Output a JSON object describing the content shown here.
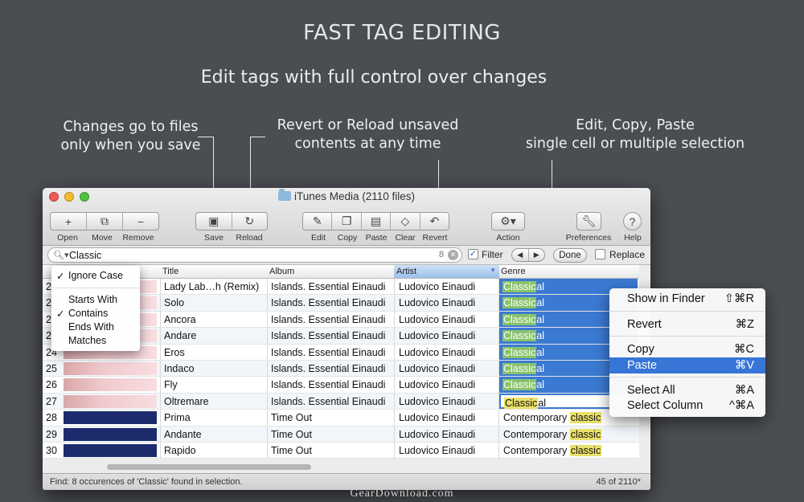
{
  "headline": "FAST TAG EDITING",
  "subhead": "Edit tags with full control over changes",
  "callouts": {
    "save": [
      "Changes go to files",
      "only when you save"
    ],
    "revert": [
      "Revert or Reload unsaved",
      "contents at any time"
    ],
    "edit": [
      "Edit, Copy, Paste",
      "single cell or multiple selection"
    ]
  },
  "window": {
    "title": "iTunes Media (2110 files)",
    "toolbar": {
      "open": "Open",
      "move": "Move",
      "remove": "Remove",
      "save": "Save",
      "reload": "Reload",
      "edit": "Edit",
      "copy": "Copy",
      "paste": "Paste",
      "clear": "Clear",
      "revert": "Revert",
      "action": "Action",
      "preferences": "Preferences",
      "help": "Help"
    },
    "search": {
      "value": "Classic",
      "count": "8",
      "filter_label": "Filter",
      "done_label": "Done",
      "replace_label": "Replace"
    },
    "columns": {
      "title": "Title",
      "album": "Album",
      "artist": "Artist",
      "genre": "Genre"
    },
    "rows": [
      {
        "num": "2",
        "title": "Lady Lab…h (Remix)",
        "album": "Islands. Essential Einaudi",
        "artist": "Ludovico Einaudi",
        "genre_match": "Classic",
        "genre_rest": "al"
      },
      {
        "num": "2",
        "title": "Solo",
        "album": "Islands. Essential Einaudi",
        "artist": "Ludovico Einaudi",
        "genre_match": "Classic",
        "genre_rest": "al"
      },
      {
        "num": "2",
        "title": "Ancora",
        "album": "Islands. Essential Einaudi",
        "artist": "Ludovico Einaudi",
        "genre_match": "Classic",
        "genre_rest": "al"
      },
      {
        "num": "2",
        "title": "Andare",
        "album": "Islands. Essential Einaudi",
        "artist": "Ludovico Einaudi",
        "genre_match": "Classic",
        "genre_rest": "al"
      },
      {
        "num": "24",
        "title": "Eros",
        "album": "Islands. Essential Einaudi",
        "artist": "Ludovico Einaudi",
        "genre_match": "Classic",
        "genre_rest": "al"
      },
      {
        "num": "25",
        "title": "Indaco",
        "album": "Islands. Essential Einaudi",
        "artist": "Ludovico Einaudi",
        "genre_match": "Classic",
        "genre_rest": "al"
      },
      {
        "num": "26",
        "title": "Fly",
        "album": "Islands. Essential Einaudi",
        "artist": "Ludovico Einaudi",
        "genre_match": "Classic",
        "genre_rest": "al"
      },
      {
        "num": "27",
        "title": "Oltremare",
        "album": "Islands. Essential Einaudi",
        "artist": "Ludovico Einaudi",
        "genre_match": "Classic",
        "genre_rest": "al"
      },
      {
        "num": "28",
        "title": "Prima",
        "album": "Time Out",
        "artist": "Ludovico Einaudi",
        "genre_pre": "Contemporary ",
        "genre_match2": "classic"
      },
      {
        "num": "29",
        "title": "Andante",
        "album": "Time Out",
        "artist": "Ludovico Einaudi",
        "genre_pre": "Contemporary ",
        "genre_match2": "classic"
      },
      {
        "num": "30",
        "title": "Rapido",
        "album": "Time Out",
        "artist": "Ludovico Einaudi",
        "genre_pre": "Contemporary ",
        "genre_match2": "classic"
      }
    ],
    "status_left": "Find: 8 occurences of 'Classic' found in selection.",
    "status_right": "45 of 2110*"
  },
  "search_options": {
    "ignore_case": "Ignore Case",
    "starts_with": "Starts With",
    "contains": "Contains",
    "ends_with": "Ends With",
    "matches": "Matches",
    "check": "✓"
  },
  "context_menu": {
    "show_in_finder": "Show in Finder",
    "show_in_finder_sc": "⇧⌘R",
    "revert": "Revert",
    "revert_sc": "⌘Z",
    "copy": "Copy",
    "copy_sc": "⌘C",
    "paste": "Paste",
    "paste_sc": "⌘V",
    "select_all": "Select All",
    "select_all_sc": "⌘A",
    "select_column": "Select Column",
    "select_column_sc": "^⌘A"
  },
  "watermark": "GearDownload.com",
  "colors": {
    "background": "#4a4d52",
    "selection": "#3b7ad3",
    "match_highlight": "#e8e06a"
  }
}
